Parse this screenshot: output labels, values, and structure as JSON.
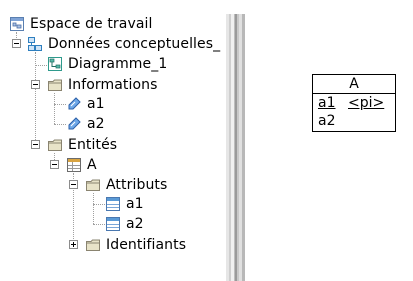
{
  "tree": {
    "root": "Espace de travail",
    "model": "Données conceptuelles_",
    "diagram": "Diagramme_1",
    "informations": "Informations",
    "info_a1": "a1",
    "info_a2": "a2",
    "entites": "Entités",
    "entity_a": "A",
    "attributs": "Attributs",
    "attr_a1": "a1",
    "attr_a2": "a2",
    "identifiants": "Identifiants"
  },
  "diagram_entity": {
    "name": "A",
    "attributes": [
      {
        "name": "a1",
        "marker": "<pi>"
      },
      {
        "name": "a2",
        "marker": ""
      }
    ]
  },
  "icons": {
    "workspace": "workspace-icon",
    "model": "conceptual-model-icon",
    "diagram": "diagram-icon",
    "folder": "folder-icon",
    "information": "information-icon",
    "entity": "entity-icon",
    "attribute": "attribute-icon"
  },
  "colors": {
    "folder": "#e8e3c8",
    "model_accent": "#2e7fbf",
    "diagram_accent": "#2f9a8c"
  }
}
